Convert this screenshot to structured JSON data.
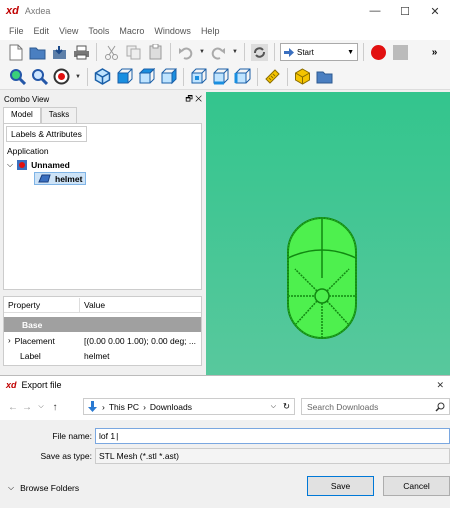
{
  "app": {
    "logo": "xd",
    "title": "Axdea",
    "window_controls": [
      "—",
      "☐",
      "✕"
    ]
  },
  "menu": [
    "File",
    "Edit",
    "View",
    "Tools",
    "Macro",
    "Windows",
    "Help"
  ],
  "toolbar": {
    "workbench": "Start",
    "overflow": "»"
  },
  "combo": {
    "title": "Combo View",
    "header_icons": "🗗 ✕",
    "tabs": [
      "Model",
      "Tasks"
    ],
    "tree_tab": "Labels & Attributes",
    "tree": {
      "root": "Application",
      "document": "Unnamed",
      "object": "helmet"
    },
    "properties": {
      "col_property": "Property",
      "col_value": "Value",
      "group": "Base",
      "rows": [
        {
          "name": "Placement",
          "value": "[(0.00 0.00 1.00); 0.00 deg; ..."
        },
        {
          "name": "Label",
          "value": "helmet"
        }
      ]
    }
  },
  "dialog": {
    "logo": "xd",
    "title": "Export file",
    "close": "✕",
    "breadcrumb": [
      "This PC",
      "Downloads"
    ],
    "search_placeholder": "Search Downloads",
    "file_name_label": "File name:",
    "file_name_value": "lof 1",
    "save_type_label": "Save as type:",
    "save_type_value": "STL Mesh (*.stl *.ast)",
    "browse_folders": "Browse Folders",
    "save_button": "Save",
    "cancel_button": "Cancel"
  },
  "colors": {
    "viewport_top": "#33c58d",
    "viewport_bottom": "#58c89d",
    "model_green": "#22dd22",
    "logo_red": "#c00000"
  }
}
